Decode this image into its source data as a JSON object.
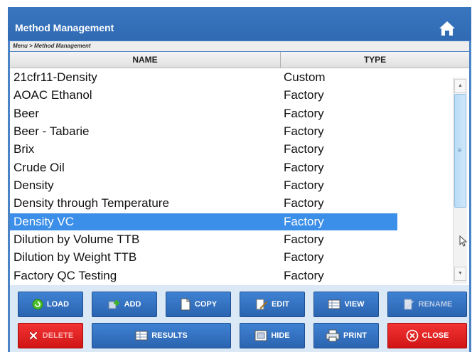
{
  "window": {
    "title": "Method Management"
  },
  "breadcrumb": "Menu > Method Management",
  "columns": {
    "name": "NAME",
    "type": "TYPE"
  },
  "rows": [
    {
      "name": "21cfr11-Density",
      "type": "Custom"
    },
    {
      "name": "AOAC Ethanol",
      "type": "Factory"
    },
    {
      "name": "Beer",
      "type": "Factory"
    },
    {
      "name": "Beer - Tabarie",
      "type": "Factory"
    },
    {
      "name": "Brix",
      "type": "Factory"
    },
    {
      "name": "Crude Oil",
      "type": "Factory"
    },
    {
      "name": "Density",
      "type": "Factory"
    },
    {
      "name": "Density through Temperature",
      "type": "Factory"
    },
    {
      "name": "Density VC",
      "type": "Factory",
      "selected": true
    },
    {
      "name": "Dilution by Volume TTB",
      "type": "Factory"
    },
    {
      "name": "Dilution by Weight TTB",
      "type": "Factory"
    },
    {
      "name": "Factory QC Testing",
      "type": "Factory"
    }
  ],
  "buttons": {
    "load": "LOAD",
    "add": "ADD",
    "copy": "COPY",
    "edit": "EDIT",
    "view": "VIEW",
    "rename": "RENAME",
    "delete": "DELETE",
    "results": "RESULTS",
    "hide": "HIDE",
    "print": "PRINT",
    "close": "CLOSE"
  },
  "icons": {
    "home": "home-icon",
    "load": "load-icon",
    "add": "add-icon",
    "copy": "copy-icon",
    "edit": "edit-icon",
    "view": "view-icon",
    "rename": "rename-icon",
    "delete": "delete-icon",
    "results": "results-icon",
    "hide": "hide-icon",
    "print": "print-icon",
    "close": "close-icon"
  },
  "colors": {
    "titlebar": "#3a76c0",
    "selection": "#3b8fe8",
    "button_blue": "#3f82d3",
    "button_red": "#e42020"
  }
}
